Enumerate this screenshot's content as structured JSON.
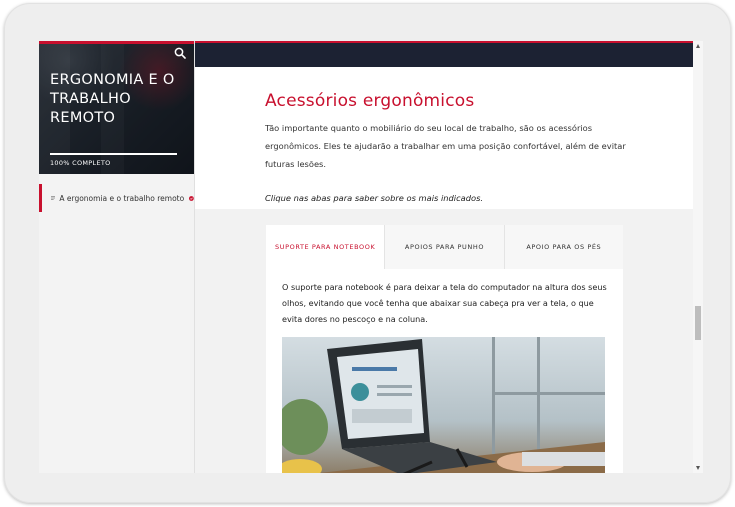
{
  "course": {
    "title": "ERGONOMIA E O TRABALHO REMOTO",
    "progress_label": "100% COMPLETO",
    "progress_fraction": 1.0
  },
  "sidebar": {
    "items": [
      {
        "label": "A ergonomia e o trabalho remoto",
        "status": "completed"
      }
    ]
  },
  "lesson": {
    "heading": "Acessórios ergonômicos",
    "intro": "Tão importante quanto o mobiliário do seu local de trabalho, são os acessórios ergonômicos. Eles te ajudarão a trabalhar em uma posição confortável, além de evitar futuras lesões.",
    "hint": "Clique nas abas para saber sobre os mais indicados.",
    "tabs": [
      {
        "label": "SUPORTE PARA NOTEBOOK",
        "active": true
      },
      {
        "label": "APOIOS PARA PUNHO",
        "active": false
      },
      {
        "label": "APOIO PARA OS PÉS",
        "active": false
      }
    ],
    "panel_text": "O suporte para notebook é para deixar a tela do computador na altura dos seus olhos, evitando que você tenha que abaixar sua cabeça pra ver a tela, o que evita dores no pescoço e na coluna."
  },
  "icons": {
    "search": "search-icon",
    "menu": "menu-lines-icon",
    "check": "check-circle-icon"
  },
  "colors": {
    "accent": "#c8102e",
    "topbar": "#1c2233"
  }
}
